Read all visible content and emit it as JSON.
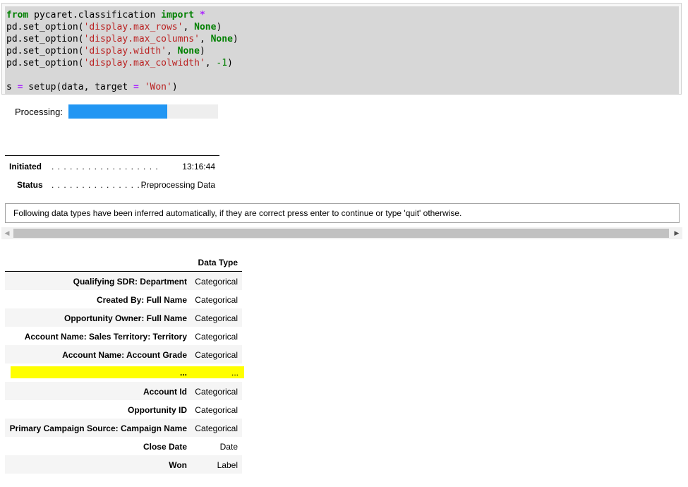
{
  "code": {
    "lines": [
      [
        {
          "t": "from",
          "c": "kw"
        },
        {
          "t": " pycaret.classification ",
          "c": ""
        },
        {
          "t": "import",
          "c": "kw"
        },
        {
          "t": " ",
          "c": ""
        },
        {
          "t": "*",
          "c": "op"
        }
      ],
      [
        {
          "t": "pd.set_option(",
          "c": ""
        },
        {
          "t": "'display.max_rows'",
          "c": "st"
        },
        {
          "t": ", ",
          "c": ""
        },
        {
          "t": "None",
          "c": "none"
        },
        {
          "t": ")",
          "c": ""
        }
      ],
      [
        {
          "t": "pd.set_option(",
          "c": ""
        },
        {
          "t": "'display.max_columns'",
          "c": "st"
        },
        {
          "t": ", ",
          "c": ""
        },
        {
          "t": "None",
          "c": "none"
        },
        {
          "t": ")",
          "c": ""
        }
      ],
      [
        {
          "t": "pd.set_option(",
          "c": ""
        },
        {
          "t": "'display.width'",
          "c": "st"
        },
        {
          "t": ", ",
          "c": ""
        },
        {
          "t": "None",
          "c": "none"
        },
        {
          "t": ")",
          "c": ""
        }
      ],
      [
        {
          "t": "pd.set_option(",
          "c": ""
        },
        {
          "t": "'display.max_colwidth'",
          "c": "st"
        },
        {
          "t": ", ",
          "c": ""
        },
        {
          "t": "-1",
          "c": "num"
        },
        {
          "t": ")",
          "c": ""
        }
      ],
      [],
      [
        {
          "t": "s ",
          "c": ""
        },
        {
          "t": "=",
          "c": "op"
        },
        {
          "t": " setup(data, target ",
          "c": ""
        },
        {
          "t": "=",
          "c": "op"
        },
        {
          "t": " ",
          "c": ""
        },
        {
          "t": "'Won'",
          "c": "st"
        },
        {
          "t": ")",
          "c": ""
        }
      ]
    ]
  },
  "processing": {
    "label": "Processing:",
    "progress": 0.66,
    "fill_color": "#2196f3"
  },
  "status": {
    "initiated_label": "Initiated",
    "initiated_dots": ". . . . . . . . . . . . . . . . . .",
    "initiated_value": "13:16:44",
    "status_label": "Status",
    "status_dots": ". . . . . . . . . . . . . . . . . .",
    "status_value": "Preprocessing Data"
  },
  "info": {
    "message": "Following data types have been inferred automatically, if they are correct press enter to continue or type 'quit' otherwise."
  },
  "dtypes": {
    "header": "Data Type",
    "rows_top": [
      {
        "name": "Qualifying SDR: Department",
        "type": "Categorical"
      },
      {
        "name": "Created By: Full Name",
        "type": "Categorical"
      },
      {
        "name": "Opportunity Owner: Full Name",
        "type": "Categorical"
      },
      {
        "name": "Account Name: Sales Territory: Territory",
        "type": "Categorical"
      },
      {
        "name": "Account Name: Account Grade",
        "type": "Categorical"
      }
    ],
    "ellipsis": {
      "name": "...",
      "type": "..."
    },
    "rows_bottom": [
      {
        "name": "Account Id",
        "type": "Categorical"
      },
      {
        "name": "Opportunity ID",
        "type": "Categorical"
      },
      {
        "name": "Primary Campaign Source: Campaign Name",
        "type": "Categorical"
      },
      {
        "name": "Close Date",
        "type": "Date"
      },
      {
        "name": "Won",
        "type": "Label"
      }
    ]
  }
}
